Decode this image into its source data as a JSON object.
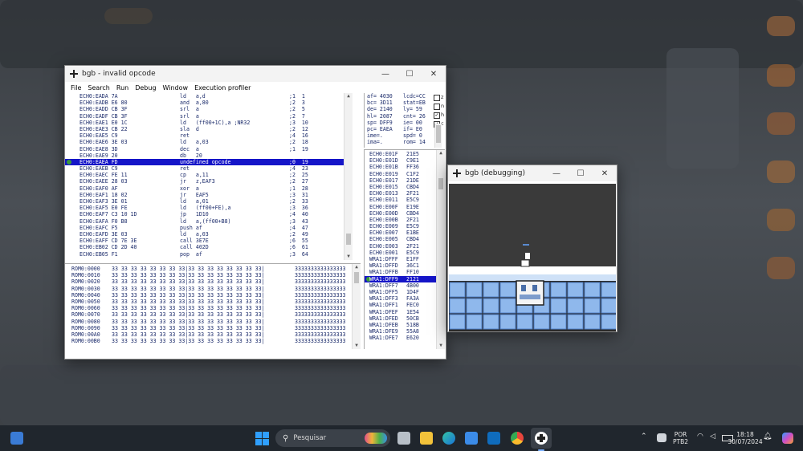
{
  "colors": {
    "selection": "#1515c8",
    "code_text": "#1a2a6a",
    "taskbar": "#20262d",
    "gb_sky": "#3a3a3a",
    "gb_tile": "#8fb8ec"
  },
  "debugger": {
    "title": "bgb - invalid opcode",
    "menu": [
      "File",
      "Search",
      "Run",
      "Debug",
      "Window",
      "Execution profiler"
    ],
    "disasm": [
      {
        "addr": "ECH0:EADA 7A",
        "op": "ld   a,d",
        "cyc": ";1  1"
      },
      {
        "addr": "ECH0:EADB E6 80",
        "op": "and  a,80",
        "cyc": ";2  3"
      },
      {
        "addr": "ECH0:EADD CB 3F",
        "op": "srl  a",
        "cyc": ";2  5"
      },
      {
        "addr": "ECH0:EADF CB 3F",
        "op": "srl  a",
        "cyc": ";2  7"
      },
      {
        "addr": "ECH0:EAE1 E0 1C",
        "op": "ld   (ff00+1C),a ;NR32",
        "cyc": ";3  10"
      },
      {
        "addr": "ECH0:EAE3 CB 22",
        "op": "sla  d",
        "cyc": ";2  12"
      },
      {
        "addr": "ECH0:EAE5 C9",
        "op": "ret",
        "cyc": ";4  16"
      },
      {
        "addr": "ECH0:EAE6 3E 03",
        "op": "ld   a,03",
        "cyc": ";2  18"
      },
      {
        "addr": "ECH0:EAE8 3D",
        "op": "dec  a",
        "cyc": ";1  19"
      },
      {
        "addr": "ECH0:EAE9 20",
        "op": "db   20",
        "cyc": ""
      },
      {
        "addr": "ECH0:EAEA FD",
        "op": "undefined opcode",
        "cyc": ";0  19",
        "sel": true
      },
      {
        "addr": "ECH0:EAEB C9",
        "op": "ret",
        "cyc": ";4  23"
      },
      {
        "addr": "ECH0:EAEC FE 11",
        "op": "cp   a,11",
        "cyc": ";2  25"
      },
      {
        "addr": "ECH0:EAEE 28 03",
        "op": "jr   z,EAF3",
        "cyc": ";2  27"
      },
      {
        "addr": "ECH0:EAF0 AF",
        "op": "xor  a",
        "cyc": ";1  28"
      },
      {
        "addr": "ECH0:EAF1 18 02",
        "op": "jr   EAF5",
        "cyc": ";3  31"
      },
      {
        "addr": "ECH0:EAF3 3E 01",
        "op": "ld   a,01",
        "cyc": ";2  33"
      },
      {
        "addr": "ECH0:EAF5 E0 FE",
        "op": "ld   (ff00+FE),a",
        "cyc": ";3  36"
      },
      {
        "addr": "ECH0:EAF7 C3 10 1D",
        "op": "jp   1D10",
        "cyc": ";4  40"
      },
      {
        "addr": "ECH0:EAFA F0 B8",
        "op": "ld   a,(ff00+B8)",
        "cyc": ";3  43"
      },
      {
        "addr": "ECH0:EAFC F5",
        "op": "push af",
        "cyc": ";4  47"
      },
      {
        "addr": "ECH0:EAFD 3E 03",
        "op": "ld   a,03",
        "cyc": ";2  49"
      },
      {
        "addr": "ECH0:EAFF CD 7E 3E",
        "op": "call 3E7E",
        "cyc": ";6  55"
      },
      {
        "addr": "ECH0:EB02 CD 2D 40",
        "op": "call 402D",
        "cyc": ";6  61"
      },
      {
        "addr": "ECH0:EB05 F1",
        "op": "pop  af",
        "cyc": ";3  64"
      }
    ],
    "memory": [
      {
        "addr": "ROM0:0000",
        "hex": "33 33 33 33 33 33 33 33|33 33 33 33 33 33 33 33|",
        "ascii": "3333333333333333"
      },
      {
        "addr": "ROM0:0010",
        "hex": "33 33 33 33 33 33 33 33|33 33 33 33 33 33 33 33|",
        "ascii": "3333333333333333"
      },
      {
        "addr": "ROM0:0020",
        "hex": "33 33 33 33 33 33 33 33|33 33 33 33 33 33 33 33|",
        "ascii": "3333333333333333"
      },
      {
        "addr": "ROM0:0030",
        "hex": "33 33 33 33 33 33 33 33|33 33 33 33 33 33 33 33|",
        "ascii": "3333333333333333"
      },
      {
        "addr": "ROM0:0040",
        "hex": "33 33 33 33 33 33 33 33|33 33 33 33 33 33 33 33|",
        "ascii": "3333333333333333"
      },
      {
        "addr": "ROM0:0050",
        "hex": "33 33 33 33 33 33 33 33|33 33 33 33 33 33 33 33|",
        "ascii": "3333333333333333"
      },
      {
        "addr": "ROM0:0060",
        "hex": "33 33 33 33 33 33 33 33|33 33 33 33 33 33 33 33|",
        "ascii": "3333333333333333"
      },
      {
        "addr": "ROM0:0070",
        "hex": "33 33 33 33 33 33 33 33|33 33 33 33 33 33 33 33|",
        "ascii": "3333333333333333"
      },
      {
        "addr": "ROM0:0080",
        "hex": "33 33 33 33 33 33 33 33|33 33 33 33 33 33 33 33|",
        "ascii": "3333333333333333"
      },
      {
        "addr": "ROM0:0090",
        "hex": "33 33 33 33 33 33 33 33|33 33 33 33 33 33 33 33|",
        "ascii": "3333333333333333"
      },
      {
        "addr": "ROM0:00A0",
        "hex": "33 33 33 33 33 33 33 33|33 33 33 33 33 33 33 33|",
        "ascii": "3333333333333333"
      },
      {
        "addr": "ROM0:00B0",
        "hex": "33 33 33 33 33 33 33 33|33 33 33 33 33 33 33 33|",
        "ascii": "3333333333333333"
      }
    ],
    "registers": [
      {
        "l": "af= 4030",
        "r": "lcdc=CC"
      },
      {
        "l": "bc= 3D11",
        "r": "stat=EB"
      },
      {
        "l": "de= 2140",
        "r": "ly= 59"
      },
      {
        "l": "hl= 2087",
        "r": "cnt= 26"
      },
      {
        "l": "sp= DFF9",
        "r": "ie= 00"
      },
      {
        "l": "pc= EAEA",
        "r": "if= E0"
      },
      {
        "l": "ime=.",
        "r": "spd= 0"
      },
      {
        "l": "ima=.",
        "r": "rom= 14"
      }
    ],
    "flag_checks": [
      {
        "label": "z",
        "checked": false
      },
      {
        "label": "n",
        "checked": false
      },
      {
        "label": "h",
        "checked": true
      },
      {
        "label": "c",
        "checked": true
      }
    ],
    "stack": [
      {
        "addr": "ECH0:E01F",
        "val": "21E5"
      },
      {
        "addr": "ECH0:E01D",
        "val": "C9E1"
      },
      {
        "addr": "ECH0:E01B",
        "val": "FF36"
      },
      {
        "addr": "ECH0:E019",
        "val": "C1F2"
      },
      {
        "addr": "ECH0:E017",
        "val": "21DE"
      },
      {
        "addr": "ECH0:E015",
        "val": "CBD4"
      },
      {
        "addr": "ECH0:E013",
        "val": "2F21"
      },
      {
        "addr": "ECH0:E011",
        "val": "E5C9"
      },
      {
        "addr": "ECH0:E00F",
        "val": "E19E"
      },
      {
        "addr": "ECH0:E00D",
        "val": "CBD4"
      },
      {
        "addr": "ECH0:E00B",
        "val": "2F21"
      },
      {
        "addr": "ECH0:E009",
        "val": "E5C9"
      },
      {
        "addr": "ECH0:E007",
        "val": "E1BE"
      },
      {
        "addr": "ECH0:E005",
        "val": "CBD4"
      },
      {
        "addr": "ECH0:E003",
        "val": "2F21"
      },
      {
        "addr": "ECH0:E001",
        "val": "E5C9"
      },
      {
        "addr": "WRA1:DFFF",
        "val": "E1FF"
      },
      {
        "addr": "WRA1:DFFD",
        "val": "36C1"
      },
      {
        "addr": "WRA1:DFFB",
        "val": "FF10"
      },
      {
        "addr": "WRA1:DFF9",
        "val": "2121",
        "sel": true
      },
      {
        "addr": "WRA1:DFF7",
        "val": "4B00"
      },
      {
        "addr": "WRA1:DFF5",
        "val": "1D4F"
      },
      {
        "addr": "WRA1:DFF3",
        "val": "FA3A"
      },
      {
        "addr": "WRA1:DFF1",
        "val": "FEC0"
      },
      {
        "addr": "WRA1:DFEF",
        "val": "1E54"
      },
      {
        "addr": "WRA1:DFED",
        "val": "50CB"
      },
      {
        "addr": "WRA1:DFEB",
        "val": "518B"
      },
      {
        "addr": "WRA1:DFE9",
        "val": "55A8"
      },
      {
        "addr": "WRA1:DFE7",
        "val": "E620"
      }
    ]
  },
  "game_window": {
    "title": "bgb (debugging)"
  },
  "window_controls": {
    "minimize": "—",
    "maximize": "☐",
    "close": "✕"
  },
  "taskbar": {
    "search_placeholder": "Pesquisar",
    "language": "POR",
    "layout": "PTB2",
    "time": "18:18",
    "date": "30/07/2024",
    "tray_chevron": "⌃"
  }
}
